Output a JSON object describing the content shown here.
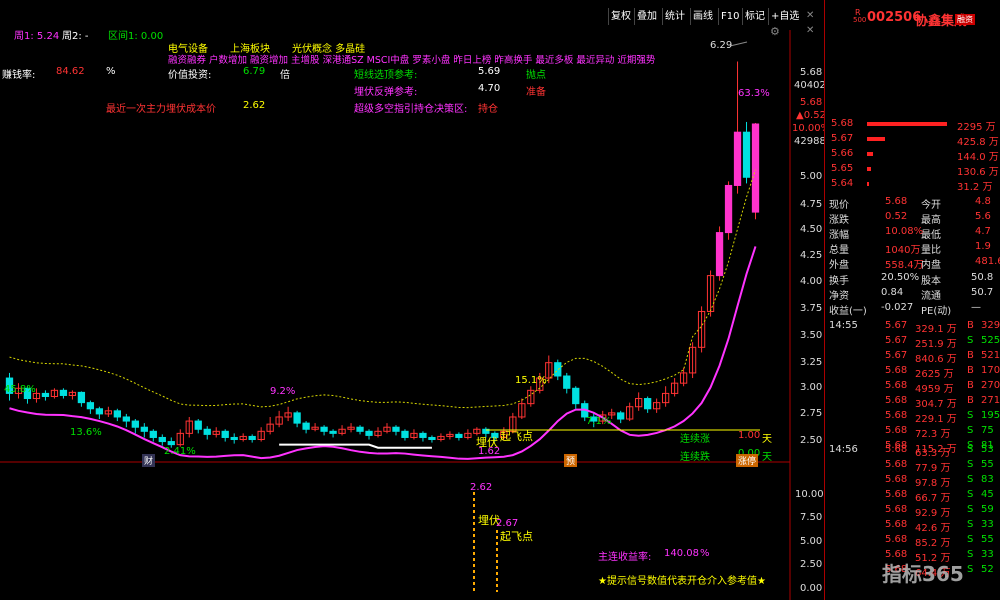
{
  "toolbar": {
    "buttons": [
      "复权",
      "叠加",
      "统计",
      "画线",
      "F10",
      "标记",
      "+自选"
    ]
  },
  "period_labels": {
    "week1": "周1: 5.24",
    "week2": "周2: -",
    "interval": "区间1: 0.00"
  },
  "info": {
    "sector1": "电气设备",
    "sector2": "上海板块",
    "concept": "光伏概念 多晶硅",
    "tags": "融资融券 户数增加 融资增加 主增股 深港通SZ MSCI中盘 罗素小盘 昨日上榜 昨高换手 最近多板 最近异动 近期强势",
    "earn_label": "赚钱率:",
    "earn_value": "84.62",
    "earn_unit": "%",
    "value_label": "价值投资:",
    "value_value": "6.79",
    "value_unit": "倍",
    "short_label": "短线选顶参考:",
    "short_value": "5.69",
    "short_tag": "抛点",
    "bury_label": "埋伏反弹参考:",
    "bury_value": "4.70",
    "bury_tag": "准备",
    "cost_label": "最近一次主力埋伏成本价",
    "cost_value": "2.62",
    "super_label": "超级多空指引持仓决策区:",
    "super_tag": "持仓"
  },
  "annotations": {
    "peak": "6.29",
    "peak_pct": "63.3%",
    "low_pct": "2.41%",
    "pct_13": "13.6%",
    "pct_45": "45.8%",
    "pct_92": "9.2%",
    "pct_151": "15.1%",
    "pct_71": "7.1%",
    "mark_fly": "起飞点",
    "mark_bury": "埋伏",
    "mark_162": "1.62",
    "rise_label": "连续涨",
    "rise_val": "1.00",
    "rise_unit": "天",
    "fall_label": "连续跌",
    "fall_val": "0.00",
    "fall_unit": "天",
    "cai": "财",
    "yu": "预",
    "fei": "涨停"
  },
  "lower": {
    "v262": "2.62",
    "bury": "埋伏",
    "v267": "2.67",
    "fly": "起飞点",
    "profit_label": "主连收益率:",
    "profit_value": "140.08",
    "profit_unit": "%",
    "hint": "★提示信号数值代表开仓介入参考值★"
  },
  "right_axis": [
    "5.68",
    "40402",
    "5.68",
    "▲0.52",
    "10.00%",
    "42988",
    "5.00",
    "4.75",
    "4.50",
    "4.25",
    "4.00",
    "3.75",
    "3.50",
    "3.25",
    "3.00",
    "2.75",
    "2.50"
  ],
  "lower_axis": [
    "10.00",
    "7.50",
    "5.00",
    "2.50",
    "0.00"
  ],
  "stock": {
    "code_prefix": "R",
    "code": "002506",
    "name": "协鑫集成",
    "flag": "融资",
    "sub": "500"
  },
  "order_book": [
    {
      "price": "5.68",
      "vol": "2295 万"
    },
    {
      "price": "5.67",
      "vol": "425.8 万"
    },
    {
      "price": "5.66",
      "vol": "144.0 万"
    },
    {
      "price": "5.65",
      "vol": "130.6 万"
    },
    {
      "price": "5.64",
      "vol": "31.2 万"
    }
  ],
  "quote": [
    [
      "现价",
      "5.68",
      "今开",
      "4.8"
    ],
    [
      "涨跌",
      "0.52",
      "最高",
      "5.6"
    ],
    [
      "涨幅",
      "10.08%",
      "最低",
      "4.7"
    ],
    [
      "总量",
      "1040万",
      "量比",
      "1.9"
    ],
    [
      "外盘",
      "558.4万",
      "内盘",
      "481.6"
    ]
  ],
  "fin": [
    [
      "换手",
      "20.50%",
      "股本",
      "50.8"
    ],
    [
      "净资",
      "0.84",
      "流通",
      "50.7"
    ],
    [
      "收益(一)",
      "-0.027",
      "PE(动)",
      "—"
    ]
  ],
  "ticks1": {
    "time": "14:55",
    "rows": [
      [
        "5.67",
        "329.1 万",
        "B",
        "329"
      ],
      [
        "5.67",
        "251.9 万",
        "S",
        "525"
      ],
      [
        "5.67",
        "840.6 万",
        "B",
        "521"
      ],
      [
        "5.68",
        "2625 万",
        "B",
        "1706"
      ],
      [
        "5.68",
        "4959 万",
        "B",
        "2705"
      ],
      [
        "5.68",
        "304.7 万",
        "B",
        "271"
      ],
      [
        "5.68",
        "229.1 万",
        "S",
        "195"
      ],
      [
        "5.68",
        "72.3 万",
        "S",
        "75"
      ],
      [
        "5.68",
        "115.2 万",
        "S",
        "81"
      ]
    ]
  },
  "ticks2": {
    "time": "14:56",
    "rows": [
      [
        "5.68",
        "63.3 万",
        "S",
        "53"
      ],
      [
        "5.68",
        "77.9 万",
        "S",
        "55"
      ],
      [
        "5.68",
        "97.8 万",
        "S",
        "83"
      ],
      [
        "5.68",
        "66.7 万",
        "S",
        "45"
      ],
      [
        "5.68",
        "92.9 万",
        "S",
        "59"
      ],
      [
        "5.68",
        "42.6 万",
        "S",
        "33"
      ],
      [
        "5.68",
        "85.2 万",
        "S",
        "55"
      ],
      [
        "5.68",
        "51.2 万",
        "S",
        "33"
      ],
      [
        "5.68",
        "64.4 万",
        "S",
        "52"
      ]
    ]
  },
  "watermark": "指标365",
  "chart_data": {
    "type": "candlestick",
    "ylim": [
      2.4,
      6.5
    ],
    "candles": [
      [
        3.2,
        3.05,
        3.25,
        2.98
      ],
      [
        3.05,
        3.1,
        3.15,
        3.0
      ],
      [
        3.1,
        3.0,
        3.12,
        2.95
      ],
      [
        3.0,
        3.05,
        3.1,
        2.96
      ],
      [
        3.05,
        3.02,
        3.08,
        2.98
      ],
      [
        3.02,
        3.08,
        3.1,
        3.0
      ],
      [
        3.08,
        3.03,
        3.1,
        3.0
      ],
      [
        3.03,
        3.06,
        3.08,
        2.99
      ],
      [
        3.06,
        2.96,
        3.07,
        2.92
      ],
      [
        2.96,
        2.9,
        2.98,
        2.85
      ],
      [
        2.9,
        2.85,
        2.92,
        2.8
      ],
      [
        2.85,
        2.88,
        2.92,
        2.82
      ],
      [
        2.88,
        2.82,
        2.9,
        2.78
      ],
      [
        2.82,
        2.78,
        2.85,
        2.72
      ],
      [
        2.78,
        2.72,
        2.8,
        2.66
      ],
      [
        2.72,
        2.68,
        2.76,
        2.62
      ],
      [
        2.68,
        2.62,
        2.7,
        2.58
      ],
      [
        2.62,
        2.58,
        2.65,
        2.54
      ],
      [
        2.58,
        2.55,
        2.62,
        2.52
      ],
      [
        2.55,
        2.66,
        2.7,
        2.53
      ],
      [
        2.66,
        2.78,
        2.82,
        2.62
      ],
      [
        2.78,
        2.7,
        2.8,
        2.66
      ],
      [
        2.7,
        2.65,
        2.73,
        2.6
      ],
      [
        2.65,
        2.68,
        2.72,
        2.62
      ],
      [
        2.68,
        2.62,
        2.7,
        2.58
      ],
      [
        2.62,
        2.6,
        2.66,
        2.56
      ],
      [
        2.6,
        2.63,
        2.66,
        2.58
      ],
      [
        2.63,
        2.6,
        2.65,
        2.57
      ],
      [
        2.6,
        2.68,
        2.72,
        2.58
      ],
      [
        2.68,
        2.75,
        2.82,
        2.65
      ],
      [
        2.75,
        2.82,
        2.88,
        2.72
      ],
      [
        2.82,
        2.86,
        2.92,
        2.78
      ],
      [
        2.86,
        2.76,
        2.88,
        2.72
      ],
      [
        2.76,
        2.7,
        2.78,
        2.66
      ],
      [
        2.7,
        2.72,
        2.76,
        2.68
      ],
      [
        2.72,
        2.68,
        2.74,
        2.64
      ],
      [
        2.68,
        2.66,
        2.7,
        2.62
      ],
      [
        2.66,
        2.7,
        2.74,
        2.64
      ],
      [
        2.7,
        2.72,
        2.76,
        2.67
      ],
      [
        2.72,
        2.68,
        2.74,
        2.65
      ],
      [
        2.68,
        2.64,
        2.7,
        2.6
      ],
      [
        2.64,
        2.68,
        2.72,
        2.62
      ],
      [
        2.68,
        2.72,
        2.76,
        2.66
      ],
      [
        2.72,
        2.68,
        2.74,
        2.64
      ],
      [
        2.68,
        2.62,
        2.7,
        2.59
      ],
      [
        2.62,
        2.66,
        2.7,
        2.6
      ],
      [
        2.66,
        2.62,
        2.68,
        2.58
      ],
      [
        2.62,
        2.6,
        2.64,
        2.57
      ],
      [
        2.6,
        2.63,
        2.66,
        2.58
      ],
      [
        2.63,
        2.65,
        2.68,
        2.6
      ],
      [
        2.65,
        2.62,
        2.67,
        2.59
      ],
      [
        2.62,
        2.66,
        2.7,
        2.6
      ],
      [
        2.66,
        2.7,
        2.72,
        2.64
      ],
      [
        2.7,
        2.66,
        2.72,
        2.62
      ],
      [
        2.66,
        2.62,
        2.68,
        2.58
      ],
      [
        2.62,
        2.68,
        2.72,
        2.6
      ],
      [
        2.68,
        2.82,
        2.86,
        2.66
      ],
      [
        2.82,
        2.95,
        3.0,
        2.8
      ],
      [
        2.95,
        3.08,
        3.12,
        2.92
      ],
      [
        3.08,
        3.2,
        3.25,
        3.05
      ],
      [
        3.2,
        3.35,
        3.42,
        3.15
      ],
      [
        3.35,
        3.22,
        3.38,
        3.18
      ],
      [
        3.22,
        3.1,
        3.25,
        3.05
      ],
      [
        3.1,
        2.95,
        3.12,
        2.9
      ],
      [
        2.95,
        2.82,
        2.98,
        2.78
      ],
      [
        2.82,
        2.78,
        2.86,
        2.72
      ],
      [
        2.78,
        2.84,
        2.88,
        2.75
      ],
      [
        2.84,
        2.86,
        2.9,
        2.8
      ],
      [
        2.86,
        2.8,
        2.88,
        2.76
      ],
      [
        2.8,
        2.92,
        2.96,
        2.78
      ],
      [
        2.92,
        3.0,
        3.06,
        2.88
      ],
      [
        3.0,
        2.9,
        3.02,
        2.86
      ],
      [
        2.9,
        2.96,
        3.0,
        2.86
      ],
      [
        2.96,
        3.05,
        3.12,
        2.92
      ],
      [
        3.05,
        3.15,
        3.2,
        3.02
      ],
      [
        3.15,
        3.25,
        3.3,
        3.12
      ],
      [
        3.25,
        3.5,
        3.55,
        3.2
      ],
      [
        3.5,
        3.85,
        3.9,
        3.45
      ],
      [
        3.85,
        4.2,
        4.25,
        3.8
      ],
      [
        4.2,
        4.62,
        4.68,
        4.15
      ],
      [
        4.62,
        5.08,
        5.12,
        4.55
      ],
      [
        5.08,
        5.6,
        6.29,
        5.0
      ],
      [
        5.6,
        5.16,
        5.7,
        5.1
      ],
      [
        4.82,
        5.68,
        5.69,
        4.75
      ]
    ]
  }
}
